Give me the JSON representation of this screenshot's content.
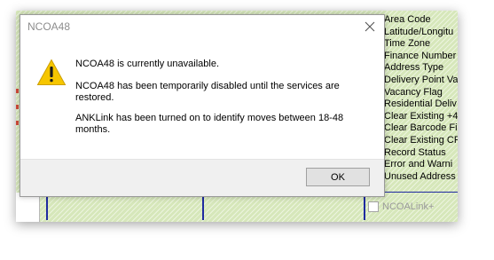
{
  "dialog": {
    "title": "NCOA48",
    "heading": "NCOA48 is currently unavailable.",
    "message_line1": "NCOA48 has been temporarily disabled until the services are restored.",
    "message_line2": "ANKLink has been turned on to identify moves between 18-48 months.",
    "ok_label": "OK",
    "icon": "warning-icon"
  },
  "background_app": {
    "field_list": [
      "Area Code",
      "Latitude/Longitu",
      "Time Zone",
      "Finance Number",
      "Address Type",
      "Delivery Point Va",
      "Vacancy Flag",
      "Residential Deliv",
      "Clear Existing +4",
      "Clear Barcode Fi",
      "Clear Existing CF",
      "Record Status",
      "Error and Warni",
      "Unused Address"
    ],
    "ncoa_link_label": "NCOALink+",
    "colors": {
      "hatch_bg": "#d6e7ba",
      "line_blue": "#1f2aa0"
    }
  }
}
